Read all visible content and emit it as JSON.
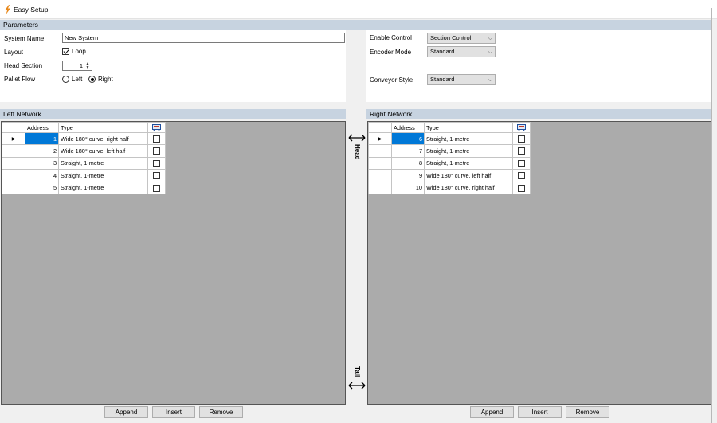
{
  "window": {
    "title": "Easy Setup",
    "icon": "lightning-icon"
  },
  "parameters": {
    "header": "Parameters",
    "system_name": {
      "label": "System Name",
      "value": "New System"
    },
    "layout": {
      "label": "Layout",
      "loop_label": "Loop",
      "loop_checked": true
    },
    "head_section": {
      "label": "Head Section",
      "value": "1"
    },
    "pallet_flow": {
      "label": "Pallet Flow",
      "options": [
        "Left",
        "Right"
      ],
      "selected": "Right"
    },
    "enable_control": {
      "label": "Enable Control",
      "value": "Section Control"
    },
    "encoder_mode": {
      "label": "Encoder Mode",
      "value": "Standard"
    },
    "conveyor_style": {
      "label": "Conveyor Style",
      "value": "Standard"
    }
  },
  "left_network": {
    "header": "Left Network",
    "columns": [
      "Address",
      "Type"
    ],
    "rows": [
      {
        "address": "1",
        "type": "Wide 180° curve, right half",
        "checked": false
      },
      {
        "address": "2",
        "type": "Wide 180° curve, left half",
        "checked": false
      },
      {
        "address": "3",
        "type": "Straight, 1-metre",
        "checked": false
      },
      {
        "address": "4",
        "type": "Straight, 1-metre",
        "checked": false
      },
      {
        "address": "5",
        "type": "Straight, 1-metre",
        "checked": false
      }
    ]
  },
  "right_network": {
    "header": "Right Network",
    "columns": [
      "Address",
      "Type"
    ],
    "rows": [
      {
        "address": "6",
        "type": "Straight, 1-metre",
        "checked": false
      },
      {
        "address": "7",
        "type": "Straight, 1-metre",
        "checked": false
      },
      {
        "address": "8",
        "type": "Straight, 1-metre",
        "checked": false
      },
      {
        "address": "9",
        "type": "Wide 180° curve, left half",
        "checked": false
      },
      {
        "address": "10",
        "type": "Wide 180° curve, right half",
        "checked": false
      }
    ]
  },
  "labels": {
    "head": "Head",
    "tail": "Tail"
  },
  "buttons": {
    "append": "Append",
    "insert": "Insert",
    "remove": "Remove"
  },
  "colors": {
    "section_header": "#c7d3e0",
    "selection": "#0078d7",
    "grid_background": "#ababab"
  }
}
